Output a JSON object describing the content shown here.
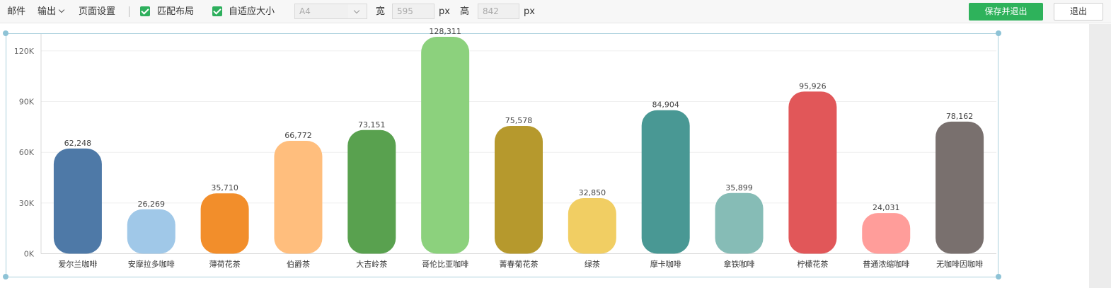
{
  "toolbar": {
    "mail": "邮件",
    "output": "输出",
    "page_settings": "页面设置",
    "match_layout": "匹配布局",
    "adaptive_size": "自适应大小",
    "paper_size": "A4",
    "width_label": "宽",
    "width_value": "595",
    "width_unit": "px",
    "height_label": "高",
    "height_value": "842",
    "height_unit": "px",
    "save_exit": "保存并退出",
    "exit": "退出"
  },
  "chart_data": {
    "type": "bar",
    "title": "",
    "xlabel": "",
    "ylabel": "",
    "ylim": [
      0,
      130000
    ],
    "yticks": [
      0,
      30000,
      60000,
      90000,
      120000
    ],
    "ytick_labels": [
      "0K",
      "30K",
      "60K",
      "90K",
      "120K"
    ],
    "grid": true,
    "categories": [
      "爱尔兰咖啡",
      "安摩拉多咖啡",
      "薄荷花茶",
      "伯爵茶",
      "大吉岭茶",
      "哥伦比亚咖啡",
      "菁春菊花茶",
      "绿茶",
      "摩卡咖啡",
      "拿铁咖啡",
      "柠檬花茶",
      "普通浓缩咖啡",
      "无咖啡因咖啡"
    ],
    "values": [
      62248,
      26269,
      35710,
      66772,
      73151,
      128311,
      75578,
      32850,
      84904,
      35899,
      95926,
      24031,
      78162
    ],
    "value_labels": [
      "62,248",
      "26,269",
      "35,710",
      "66,772",
      "73,151",
      "128,311",
      "75,578",
      "32,850",
      "84,904",
      "35,899",
      "95,926",
      "24,031",
      "78,162"
    ],
    "colors": [
      "#4e79a7",
      "#a0c8e8",
      "#f28e2b",
      "#ffbe7d",
      "#59a14f",
      "#8cd17d",
      "#b6992d",
      "#f1ce63",
      "#499894",
      "#86bcb6",
      "#e15759",
      "#ff9d9a",
      "#79706e"
    ]
  }
}
